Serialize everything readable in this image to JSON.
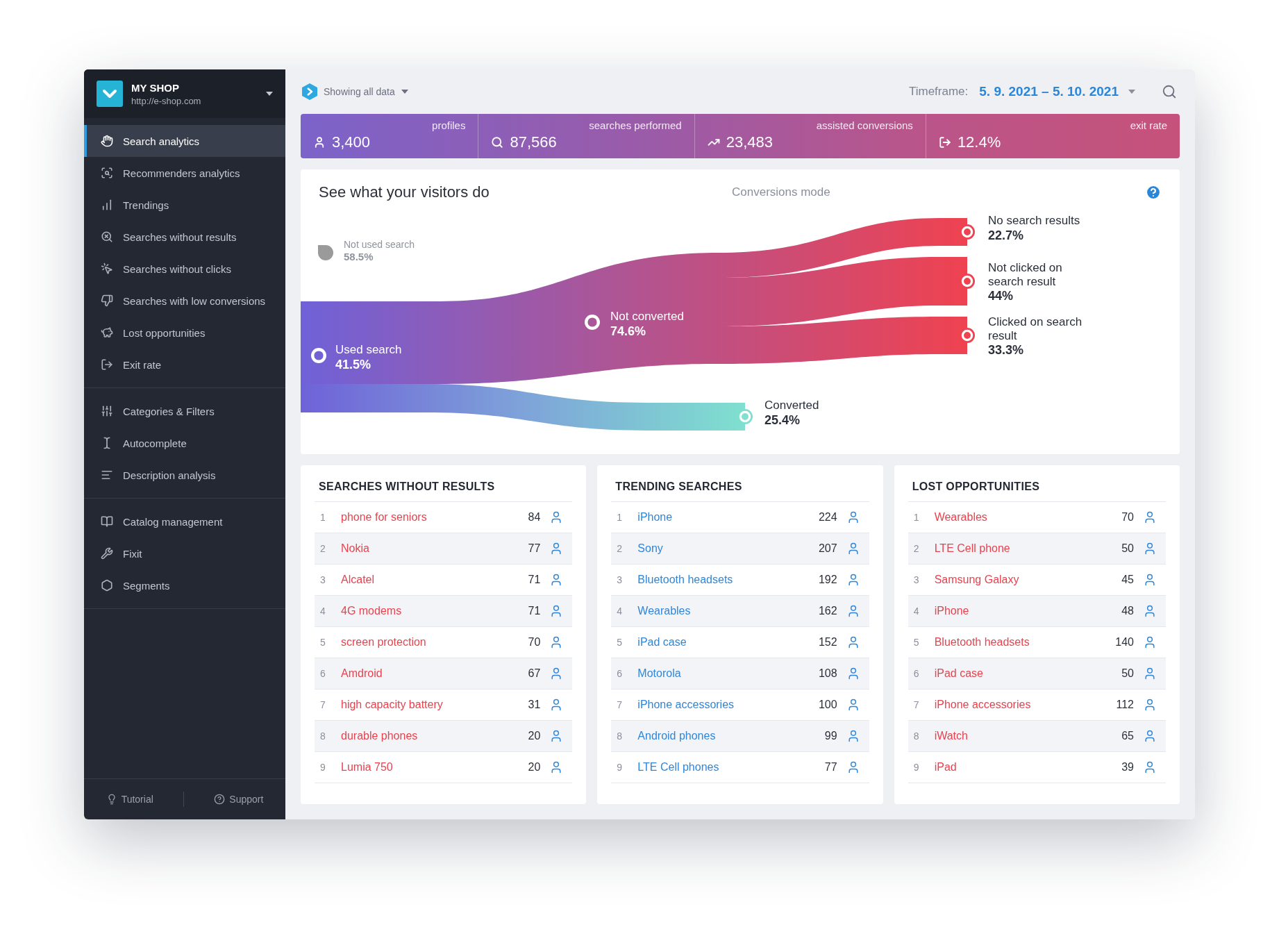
{
  "sidebar": {
    "shop": {
      "name": "MY SHOP",
      "url": "http://e-shop.com"
    },
    "groups": [
      {
        "items": [
          {
            "label": "Search analytics",
            "selected": true
          },
          {
            "label": "Recommenders analytics",
            "selected": false
          },
          {
            "label": "Trendings",
            "selected": false
          },
          {
            "label": "Searches without results",
            "selected": false
          },
          {
            "label": "Searches without clicks",
            "selected": false
          },
          {
            "label": "Searches with low conversions",
            "selected": false
          },
          {
            "label": "Lost opportunities",
            "selected": false
          },
          {
            "label": "Exit rate",
            "selected": false
          }
        ]
      },
      {
        "items": [
          {
            "label": "Categories & Filters",
            "selected": false
          },
          {
            "label": "Autocomplete",
            "selected": false
          },
          {
            "label": "Description analysis",
            "selected": false
          }
        ]
      },
      {
        "items": [
          {
            "label": "Catalog management",
            "selected": false
          },
          {
            "label": "Fixit",
            "selected": false
          },
          {
            "label": "Segments",
            "selected": false
          }
        ]
      }
    ],
    "footer": [
      "Tutorial",
      "Support"
    ]
  },
  "header": {
    "filter": "Showing all data",
    "timeframe_label": "Timeframe:",
    "timeframe": "5. 9. 2021 – 5. 10. 2021"
  },
  "stats": [
    {
      "value": "3,400",
      "label": "profiles"
    },
    {
      "value": "87,566",
      "label": "searches performed"
    },
    {
      "value": "23,483",
      "label": "assisted conversions"
    },
    {
      "value": "12.4%",
      "label": "exit rate"
    }
  ],
  "visitor_flow": {
    "title": "See what your visitors do",
    "mode": "Conversions mode",
    "nodes": [
      {
        "label": "Not used search",
        "share": "58.5%",
        "kind": "muted"
      },
      {
        "label": "Used search",
        "share": "41.5%",
        "kind": "flow"
      },
      {
        "label": "Not converted",
        "share": "74.6%",
        "kind": "flow"
      },
      {
        "label": "Converted",
        "share": "25.4%",
        "kind": "flow"
      },
      {
        "label": "No search results",
        "share": "22.7%",
        "kind": "flow"
      },
      {
        "label": "Not clicked on search result",
        "share": "44%",
        "kind": "flow"
      },
      {
        "label": "Clicked on search result",
        "share": "33.3%",
        "kind": "flow"
      }
    ]
  },
  "tables": [
    {
      "title": "SEARCHES WITHOUT RESULTS",
      "kind": "negative",
      "rows": [
        {
          "rank": "1",
          "term": "phone for seniors",
          "count": "84"
        },
        {
          "rank": "2",
          "term": "Nokia",
          "count": "77"
        },
        {
          "rank": "3",
          "term": "Alcatel",
          "count": "71"
        },
        {
          "rank": "4",
          "term": "4G modems",
          "count": "71"
        },
        {
          "rank": "5",
          "term": "screen protection",
          "count": "70"
        },
        {
          "rank": "6",
          "term": "Amdroid",
          "count": "67"
        },
        {
          "rank": "7",
          "term": "high capacity battery",
          "count": "31"
        },
        {
          "rank": "8",
          "term": "durable phones",
          "count": "20"
        },
        {
          "rank": "9",
          "term": "Lumia 750",
          "count": "20"
        }
      ]
    },
    {
      "title": "TRENDING SEARCHES",
      "kind": "positive",
      "rows": [
        {
          "rank": "1",
          "term": "iPhone",
          "count": "224"
        },
        {
          "rank": "2",
          "term": "Sony",
          "count": "207"
        },
        {
          "rank": "3",
          "term": "Bluetooth headsets",
          "count": "192"
        },
        {
          "rank": "4",
          "term": "Wearables",
          "count": "162"
        },
        {
          "rank": "5",
          "term": "iPad case",
          "count": "152"
        },
        {
          "rank": "6",
          "term": "Motorola",
          "count": "108"
        },
        {
          "rank": "7",
          "term": "iPhone accessories",
          "count": "100"
        },
        {
          "rank": "8",
          "term": "Android phones",
          "count": "99"
        },
        {
          "rank": "9",
          "term": "LTE Cell phones",
          "count": "77"
        }
      ]
    },
    {
      "title": "LOST OPPORTUNITIES",
      "kind": "negative",
      "rows": [
        {
          "rank": "1",
          "term": "Wearables",
          "count": "70"
        },
        {
          "rank": "2",
          "term": "LTE Cell phone",
          "count": "50"
        },
        {
          "rank": "3",
          "term": "Samsung Galaxy",
          "count": "45"
        },
        {
          "rank": "4",
          "term": "iPhone",
          "count": "48"
        },
        {
          "rank": "5",
          "term": "Bluetooth headsets",
          "count": "140"
        },
        {
          "rank": "6",
          "term": "iPad case",
          "count": "50"
        },
        {
          "rank": "7",
          "term": "iPhone accessories",
          "count": "112"
        },
        {
          "rank": "8",
          "term": "iWatch",
          "count": "65"
        },
        {
          "rank": "9",
          "term": "iPad",
          "count": "39"
        }
      ]
    }
  ]
}
